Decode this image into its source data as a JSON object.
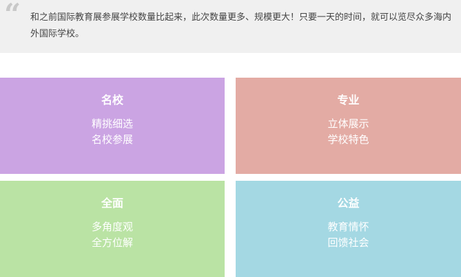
{
  "quote": {
    "mark": "“",
    "text": "和之前国际教育展参展学校数量比起来，此次数量更多、规模更大！只要一天的时间，就可以览尽众多海内外国际学校。"
  },
  "cards": [
    {
      "title": "名校",
      "lines": [
        "精挑细选",
        "名校参展"
      ],
      "color": "#cba4e3"
    },
    {
      "title": "专业",
      "lines": [
        "立体展示",
        "学校特色"
      ],
      "color": "#e3aba4"
    },
    {
      "title": "全面",
      "lines": [
        "多角度观",
        "全方位解"
      ],
      "color": "#bae3a4"
    },
    {
      "title": "公益",
      "lines": [
        "教育情怀",
        "回馈社会"
      ],
      "color": "#a4d8e3"
    }
  ]
}
